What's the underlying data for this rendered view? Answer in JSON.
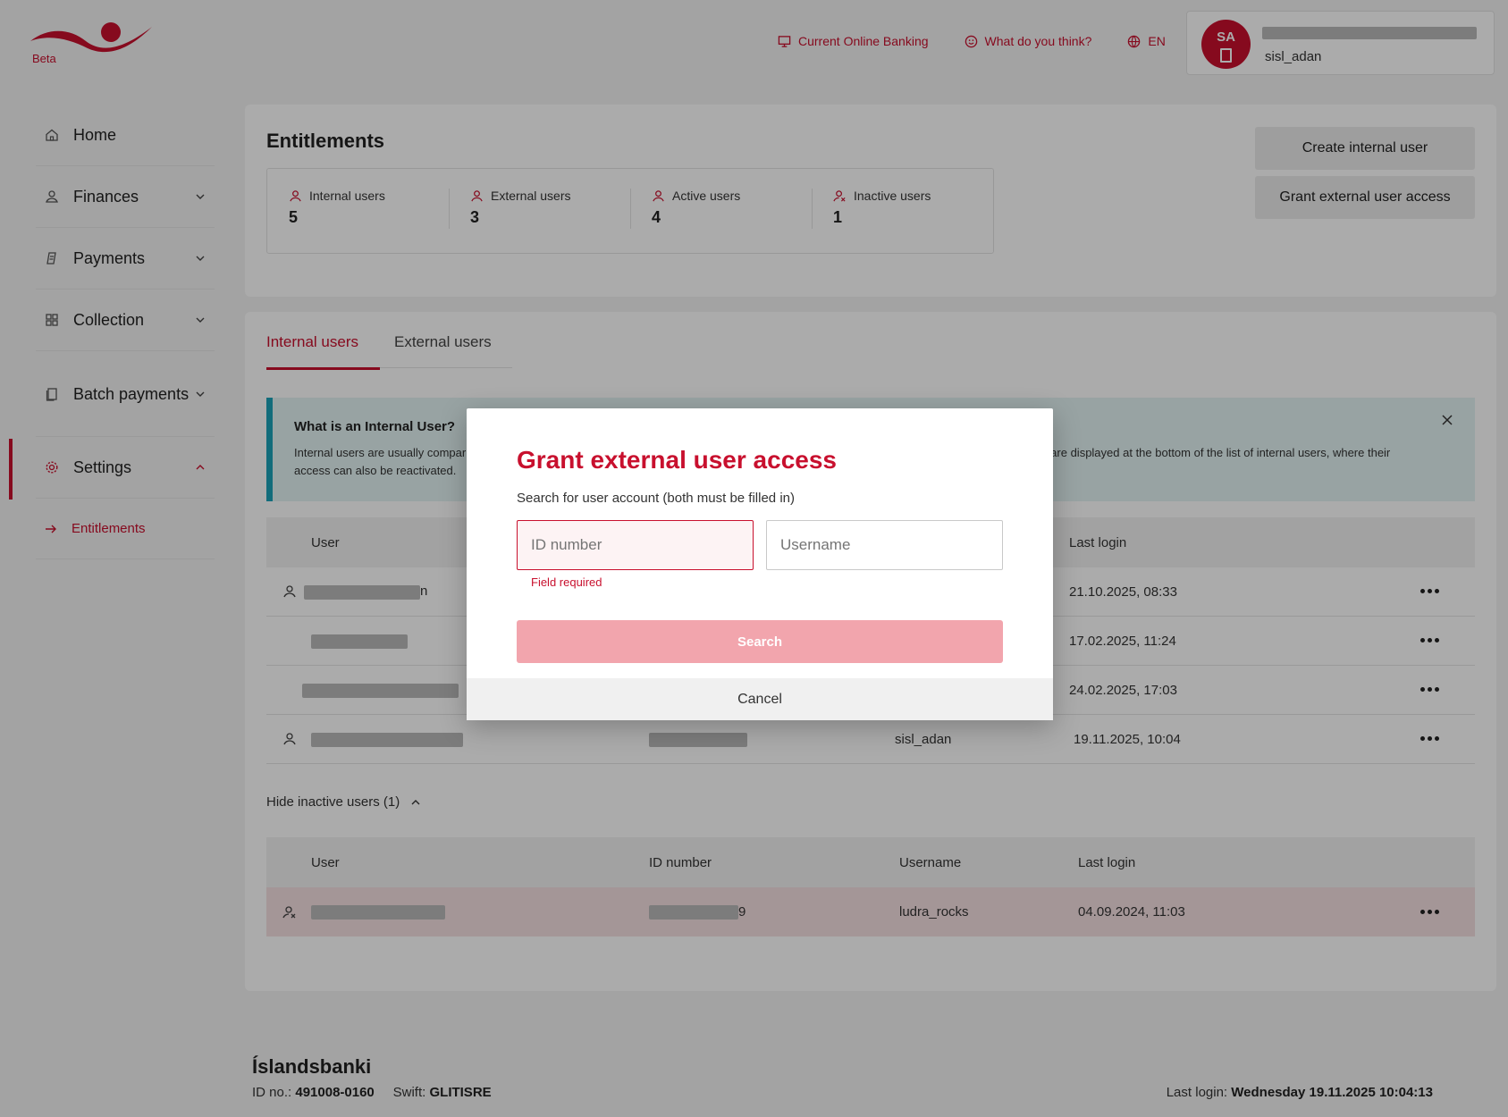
{
  "brand": {
    "beta_label": "Beta",
    "accent": "#c8102e"
  },
  "topnav": {
    "current_online_banking": "Current Online Banking",
    "feedback": "What do you think?",
    "language": "EN"
  },
  "user": {
    "initials": "SA",
    "username": "sisl_adan"
  },
  "sidebar": {
    "items": [
      {
        "label": "Home",
        "icon": "home-icon"
      },
      {
        "label": "Finances",
        "icon": "finances-icon"
      },
      {
        "label": "Payments",
        "icon": "payments-icon"
      },
      {
        "label": "Collection",
        "icon": "collection-icon"
      },
      {
        "label": "Batch payments",
        "icon": "batch-icon"
      },
      {
        "label": "Settings",
        "icon": "gear-icon"
      }
    ],
    "sub_item": "Entitlements"
  },
  "entitlements": {
    "title": "Entitlements",
    "stats": [
      {
        "label": "Internal users",
        "value": "5"
      },
      {
        "label": "External users",
        "value": "3"
      },
      {
        "label": "Active users",
        "value": "4"
      },
      {
        "label": "Inactive users",
        "value": "1"
      }
    ],
    "create_internal_user": "Create internal user",
    "grant_external_access": "Grant external user access"
  },
  "tabs": {
    "internal": "Internal users",
    "external": "External users"
  },
  "info": {
    "title": "What is an Internal User?",
    "text_left": "Internal users are usually compar",
    "text_right": "sers are displayed at the bottom of the list of internal users, where their",
    "text_line2": "access can also be reactivated."
  },
  "users_table": {
    "headers": {
      "user": "User",
      "last_login": "Last login"
    },
    "rows": [
      {
        "name_tail": "n",
        "username": "",
        "last_login": "21.10.2025, 08:33"
      },
      {
        "name_tail": "",
        "username": "",
        "last_login": "17.02.2025, 11:24"
      },
      {
        "name_tail": "",
        "username": "",
        "last_login": "24.02.2025, 17:03"
      },
      {
        "name_tail": "",
        "username": "sisl_adan",
        "last_login": "19.11.2025, 10:04"
      }
    ]
  },
  "hide_inactive": "Hide inactive users (1)",
  "inactive_table": {
    "headers": {
      "user": "User",
      "id_number": "ID number",
      "username": "Username",
      "last_login": "Last login"
    },
    "row": {
      "tail": "9",
      "username": "ludra_rocks",
      "last_login": "04.09.2024, 11:03"
    }
  },
  "footer": {
    "bank_name": "Íslandsbanki",
    "id_label": "ID no.:",
    "id_value": "491008-0160",
    "swift_label": "Swift:",
    "swift_value": "GLITISRE",
    "last_login_label": "Last login:",
    "last_login_value": "Wednesday 19.11.2025 10:04:13"
  },
  "modal": {
    "title": "Grant external user access",
    "subtitle": "Search for user account (both must be filled in)",
    "id_placeholder": "ID number",
    "username_placeholder": "Username",
    "error": "Field required",
    "search": "Search",
    "cancel": "Cancel"
  }
}
